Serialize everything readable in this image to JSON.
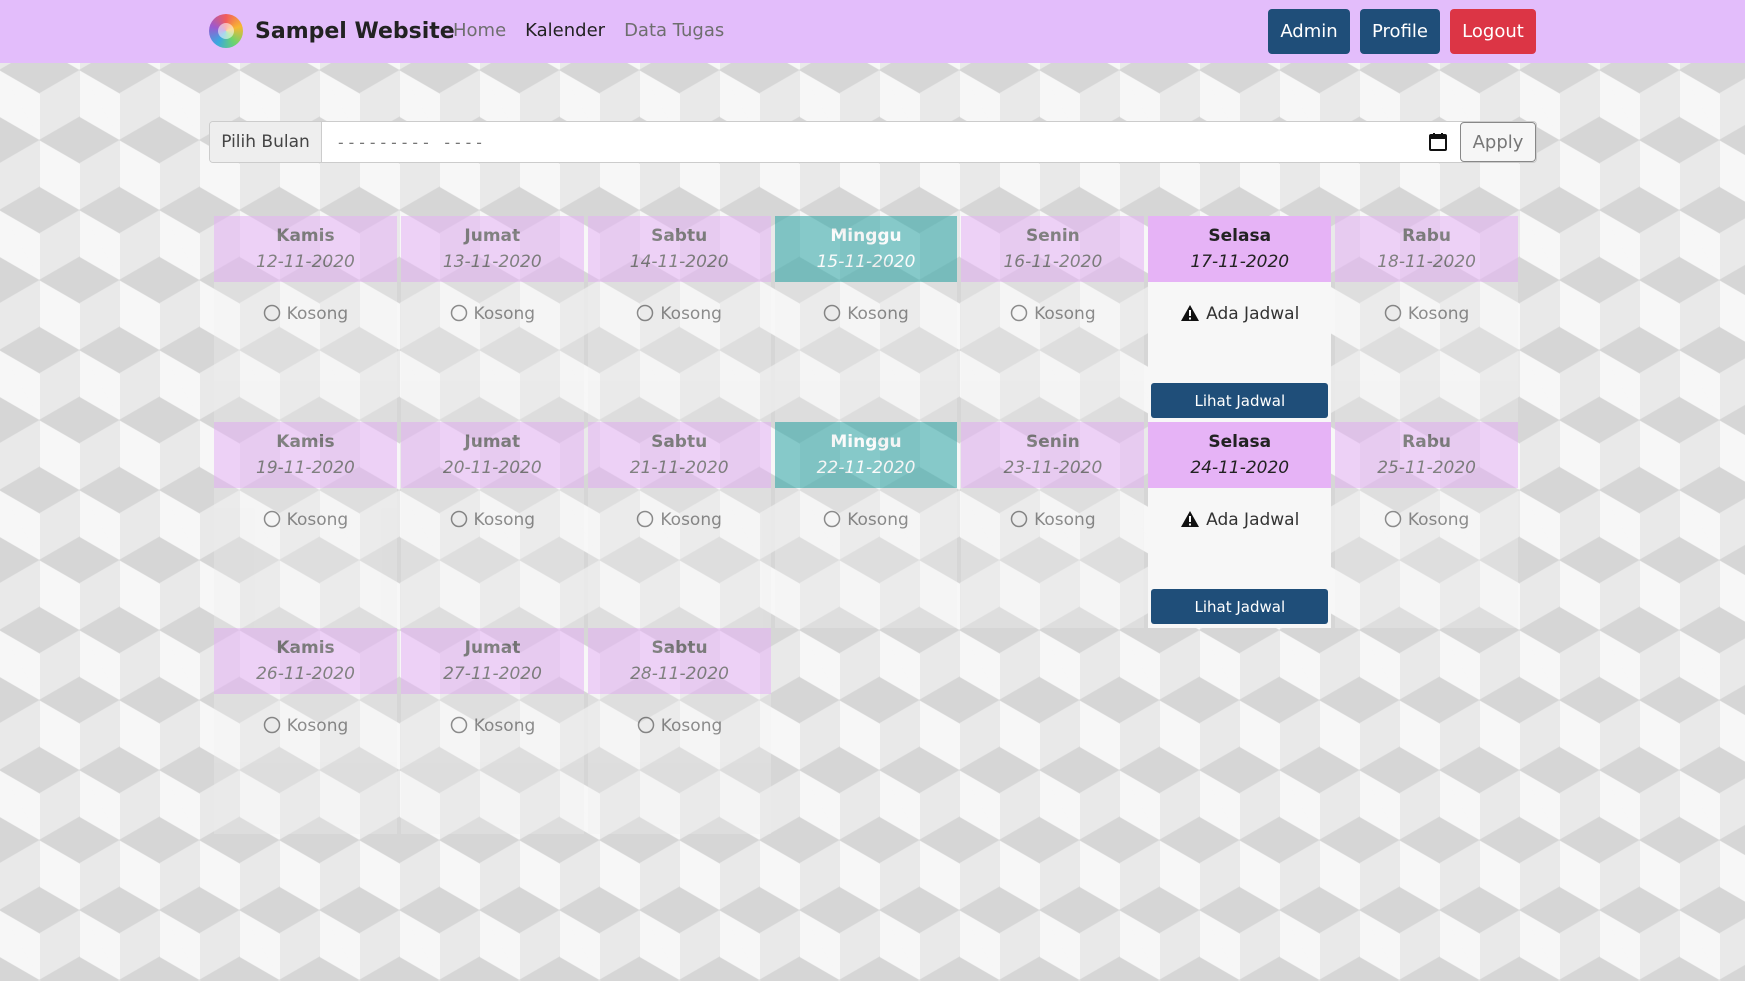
{
  "navbar": {
    "brand": "Sampel Website",
    "links": [
      "Home",
      "Kalender",
      "Data Tugas"
    ],
    "active_link": "Kalender",
    "buttons": {
      "admin": "Admin",
      "profile": "Profile",
      "logout": "Logout"
    },
    "colors": {
      "navbar_bg": "#e3bdfb",
      "primary": "#1f4e79",
      "danger": "#dc3545"
    }
  },
  "month_picker": {
    "label": "Pilih Bulan",
    "placeholder": "--------- ----",
    "apply": "Apply"
  },
  "calendar": {
    "weeks": [
      [
        {
          "name": "Kamis",
          "date": "12-11-2020",
          "status": "Kosong",
          "has_schedule": false,
          "sunday": false
        },
        {
          "name": "Jumat",
          "date": "13-11-2020",
          "status": "Kosong",
          "has_schedule": false,
          "sunday": false
        },
        {
          "name": "Sabtu",
          "date": "14-11-2020",
          "status": "Kosong",
          "has_schedule": false,
          "sunday": false
        },
        {
          "name": "Minggu",
          "date": "15-11-2020",
          "status": "Kosong",
          "has_schedule": false,
          "sunday": true
        },
        {
          "name": "Senin",
          "date": "16-11-2020",
          "status": "Kosong",
          "has_schedule": false,
          "sunday": false
        },
        {
          "name": "Selasa",
          "date": "17-11-2020",
          "status": "Ada Jadwal",
          "has_schedule": true,
          "sunday": false,
          "button": "Lihat Jadwal"
        },
        {
          "name": "Rabu",
          "date": "18-11-2020",
          "status": "Kosong",
          "has_schedule": false,
          "sunday": false
        }
      ],
      [
        {
          "name": "Kamis",
          "date": "19-11-2020",
          "status": "Kosong",
          "has_schedule": false,
          "sunday": false
        },
        {
          "name": "Jumat",
          "date": "20-11-2020",
          "status": "Kosong",
          "has_schedule": false,
          "sunday": false
        },
        {
          "name": "Sabtu",
          "date": "21-11-2020",
          "status": "Kosong",
          "has_schedule": false,
          "sunday": false
        },
        {
          "name": "Minggu",
          "date": "22-11-2020",
          "status": "Kosong",
          "has_schedule": false,
          "sunday": true
        },
        {
          "name": "Senin",
          "date": "23-11-2020",
          "status": "Kosong",
          "has_schedule": false,
          "sunday": false
        },
        {
          "name": "Selasa",
          "date": "24-11-2020",
          "status": "Ada Jadwal",
          "has_schedule": true,
          "sunday": false,
          "button": "Lihat Jadwal"
        },
        {
          "name": "Rabu",
          "date": "25-11-2020",
          "status": "Kosong",
          "has_schedule": false,
          "sunday": false
        }
      ],
      [
        {
          "name": "Kamis",
          "date": "26-11-2020",
          "status": "Kosong",
          "has_schedule": false,
          "sunday": false
        },
        {
          "name": "Jumat",
          "date": "27-11-2020",
          "status": "Kosong",
          "has_schedule": false,
          "sunday": false
        },
        {
          "name": "Sabtu",
          "date": "28-11-2020",
          "status": "Kosong",
          "has_schedule": false,
          "sunday": false
        }
      ]
    ]
  }
}
